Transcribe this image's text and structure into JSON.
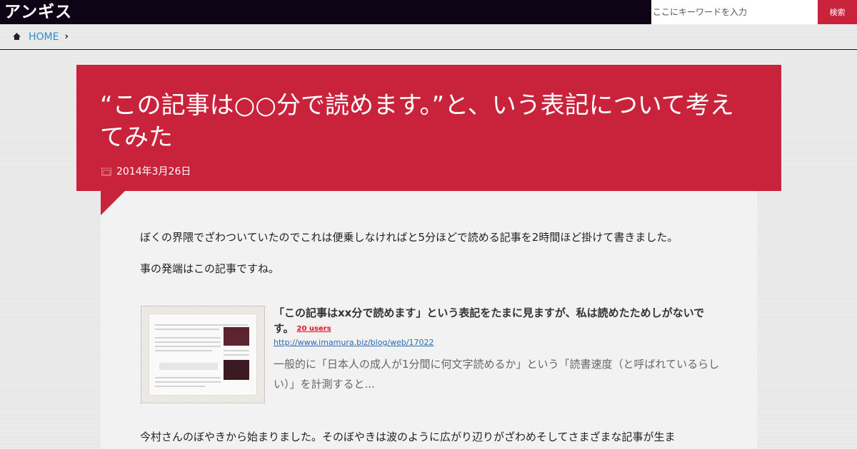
{
  "header": {
    "logo_text": "アンギス",
    "search_placeholder": "ここにキーワードを入力",
    "search_button": "検索"
  },
  "breadcrumb": {
    "home": "HOME",
    "separator": "›"
  },
  "article": {
    "title": "“この記事は○○分で読めます。”と、いう表記について考えてみた",
    "date": "2014年3月26日",
    "paragraphs": [
      "ぼくの界隈でざわついていたのでこれは便乗しなければと5分ほどで読める記事を2時間ほど掛けて書きました。",
      "事の発端はこの記事ですね。",
      "今村さんのぼやきから始まりました。そのぼやきは波のように広がり辺りがざわめそしてさまざまな記事が生ま"
    ]
  },
  "embed": {
    "title": "「この記事はxx分で読めます」という表記をたまに見ますが、私は読めたためしがないです。",
    "users": "20 users",
    "url": "http://www.imamura.biz/blog/web/17022",
    "description": "一般的に「日本人の成人が1分間に何文字読めるか」という「読書速度（と呼ばれているらしい）」を計測すると..."
  },
  "colors": {
    "topbar": "#0f0316",
    "accent": "#c8233b",
    "link": "#2a8fd0"
  },
  "icons": {
    "home": "home-icon",
    "calendar": "calendar-icon",
    "chevron": "chevron-right-icon"
  }
}
